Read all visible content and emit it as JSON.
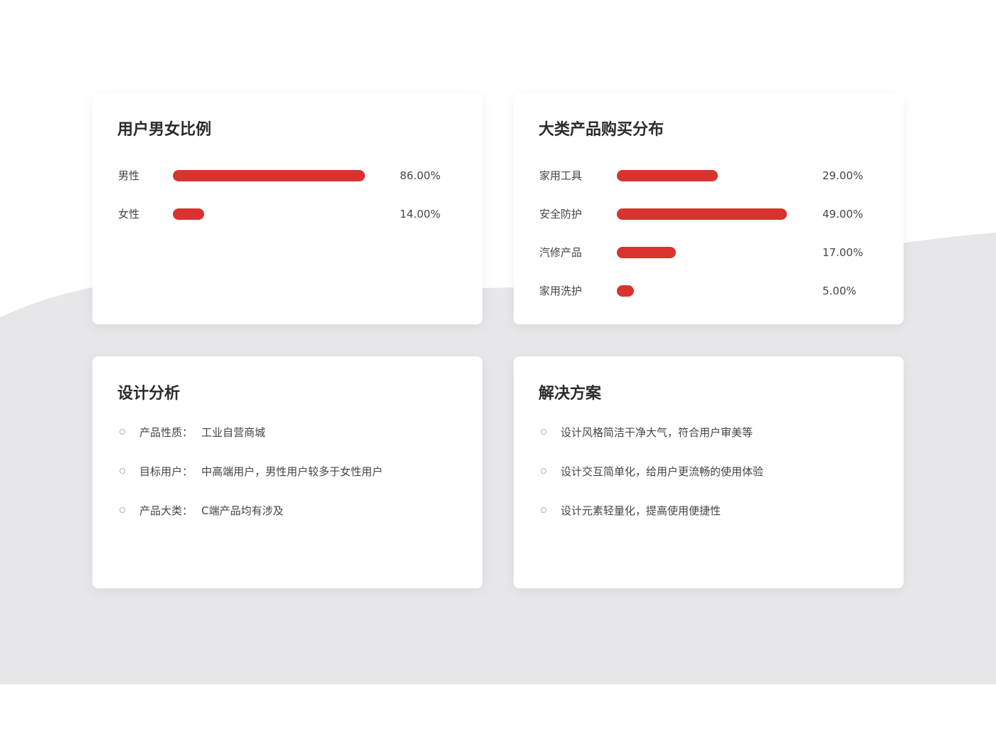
{
  "colors": {
    "accent": "#d9322f",
    "background_shape": "#e7e6e9",
    "card": "#ffffff"
  },
  "gender_card": {
    "title": "用户男女比例"
  },
  "category_card": {
    "title": "大类产品购买分布"
  },
  "design_card": {
    "title": "设计分析",
    "items": [
      {
        "label": "产品性质：",
        "text": "工业自营商城"
      },
      {
        "label": "目标用户：",
        "text": "中高端用户，男性用户较多于女性用户"
      },
      {
        "label": "产品大类：",
        "text": "C端产品均有涉及"
      }
    ]
  },
  "solution_card": {
    "title": "解决方案",
    "items": [
      {
        "text": "设计风格简洁干净大气，符合用户审美等"
      },
      {
        "text": "设计交互简单化，给用户更流畅的使用体验"
      },
      {
        "text": "设计元素轻量化，提高使用便捷性"
      }
    ]
  },
  "chart_data": [
    {
      "type": "bar",
      "title": "用户男女比例",
      "orientation": "horizontal",
      "categories": [
        "男性",
        "女性"
      ],
      "values": [
        86.0,
        14.0
      ],
      "value_labels": [
        "86.00%",
        "14.00%"
      ],
      "xlim": [
        0,
        100
      ],
      "grid": false,
      "color": "#d9322f"
    },
    {
      "type": "bar",
      "title": "大类产品购买分布",
      "orientation": "horizontal",
      "categories": [
        "家用工具",
        "安全防护",
        "汽修产品",
        "家用洗护"
      ],
      "values": [
        29.0,
        49.0,
        17.0,
        5.0
      ],
      "value_labels": [
        "29.00%",
        "49.00%",
        "17.00%",
        "5.00%"
      ],
      "xlim": [
        0,
        100
      ],
      "grid": false,
      "color": "#d9322f"
    }
  ]
}
